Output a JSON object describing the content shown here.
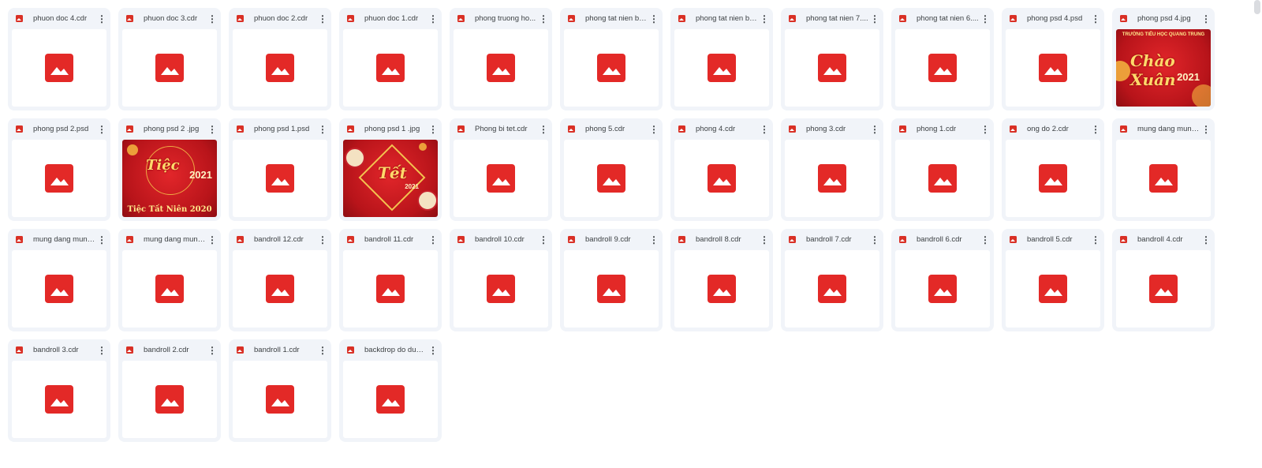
{
  "files": [
    {
      "name": "phuon doc 4.cdr",
      "preview": null
    },
    {
      "name": "phuon doc 3.cdr",
      "preview": null
    },
    {
      "name": "phuon doc 2.cdr",
      "preview": null
    },
    {
      "name": "phuon doc 1.cdr",
      "preview": null
    },
    {
      "name": "phong truong ho...",
      "preview": null
    },
    {
      "name": "phong tat nien bo...",
      "preview": null
    },
    {
      "name": "phong tat nien bo...",
      "preview": null
    },
    {
      "name": "phong tat nien 7....",
      "preview": null
    },
    {
      "name": "phong tat nien 6....",
      "preview": null
    },
    {
      "name": "phong psd 4.psd",
      "preview": null
    },
    {
      "name": "phong psd 4.jpg",
      "preview": "chao-xuan"
    },
    {
      "name": "phong psd 2.psd",
      "preview": null
    },
    {
      "name": "phong psd 2 .jpg",
      "preview": "tiec-tat-nien"
    },
    {
      "name": "phong psd 1.psd",
      "preview": null
    },
    {
      "name": "phong psd 1 .jpg",
      "preview": "tet-2021"
    },
    {
      "name": "Phong bi tet.cdr",
      "preview": null
    },
    {
      "name": "phong 5.cdr",
      "preview": null
    },
    {
      "name": "phong 4.cdr",
      "preview": null
    },
    {
      "name": "phong 3.cdr",
      "preview": null
    },
    {
      "name": "phong 1.cdr",
      "preview": null
    },
    {
      "name": "ong do 2.cdr",
      "preview": null
    },
    {
      "name": "mung dang mung...",
      "preview": null
    },
    {
      "name": "mung dang mung...",
      "preview": null
    },
    {
      "name": "mung dang mung...",
      "preview": null
    },
    {
      "name": "bandroll 12.cdr",
      "preview": null
    },
    {
      "name": "bandroll 11.cdr",
      "preview": null
    },
    {
      "name": "bandroll 10.cdr",
      "preview": null
    },
    {
      "name": "bandroll 9.cdr",
      "preview": null
    },
    {
      "name": "bandroll 8.cdr",
      "preview": null
    },
    {
      "name": "bandroll 7.cdr",
      "preview": null
    },
    {
      "name": "bandroll 6.cdr",
      "preview": null
    },
    {
      "name": "bandroll 5.cdr",
      "preview": null
    },
    {
      "name": "bandroll 4.cdr",
      "preview": null
    },
    {
      "name": "bandroll 3.cdr",
      "preview": null
    },
    {
      "name": "bandroll 2.cdr",
      "preview": null
    },
    {
      "name": "bandroll 1.cdr",
      "preview": null
    },
    {
      "name": "backdrop do dun....",
      "preview": null
    }
  ],
  "previews": {
    "chao-xuan": {
      "title": "TRƯỜNG TIỂU HỌC QUANG TRUNG",
      "main": "Chào Xuân",
      "year": "2021"
    },
    "tiec-tat-nien": {
      "main": "Tiệc",
      "year": "2021",
      "bottom": "Tiệc Tất Niên 2020"
    },
    "tet-2021": {
      "main": "Tết",
      "year": "2021"
    }
  },
  "ui": {
    "more_glyph": "⋮"
  },
  "colors": {
    "card_bg": "#f1f4f9",
    "icon_red": "#e32927",
    "text": "#3c4043"
  }
}
